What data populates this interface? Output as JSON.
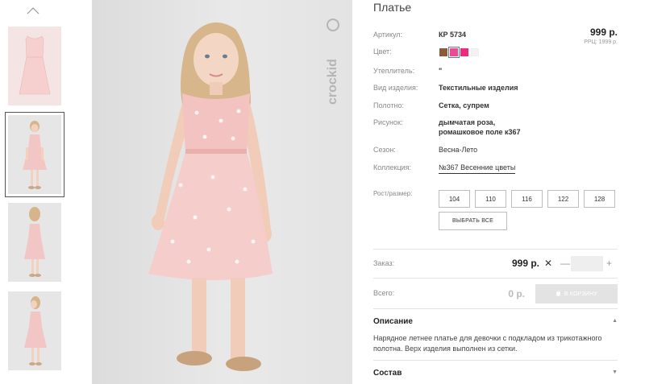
{
  "product": {
    "title": "Платье",
    "brand": "crockid",
    "price": "999 р.",
    "rrp": "РРЦ: 1999 р."
  },
  "specs": {
    "article_label": "Артикул:",
    "article_value": "КР 5734",
    "color_label": "Цвет:",
    "insulation_label": "Утеплитель:",
    "insulation_value": "\"",
    "type_label": "Вид изделия:",
    "type_value": "Текстильные изделия",
    "fabric_label": "Полотно:",
    "fabric_value": "Сетка, супрем",
    "pattern_label": "Рисунок:",
    "pattern_value_1": "дымчатая роза,",
    "pattern_value_2": "ромашковое поле к367",
    "season_label": "Сезон:",
    "season_value": "Весна-Лето",
    "collection_label": "Коллекция:",
    "collection_value": "№367 Весенние цветы"
  },
  "colors": [
    "#8a5a3c",
    "#e84a93",
    "#f0287d",
    "#f6f0f2"
  ],
  "sizes": {
    "label": "Рост/размер:",
    "options": [
      "104",
      "110",
      "116",
      "122",
      "128"
    ],
    "select_all": "ВЫБРАТЬ ВСЕ"
  },
  "order": {
    "label": "Заказ:",
    "price": "999 р.",
    "multiply": "✕",
    "minus": "—",
    "plus": "+",
    "quantity": ""
  },
  "total": {
    "label": "Всего:",
    "value": "0 р.",
    "cart_button": "В КОРЗИНУ"
  },
  "sections": {
    "description_title": "Описание",
    "description_text": "Нарядное летнее платье для девочки с подкладом из трикотажного полотна. Верх изделия выполнен из сетки.",
    "composition_title": "Состав"
  },
  "icons": {
    "up": "chevron-up-icon",
    "collapse": "chevron-up-small-icon",
    "expand": "chevron-down-small-icon",
    "cart": "cart-icon"
  }
}
